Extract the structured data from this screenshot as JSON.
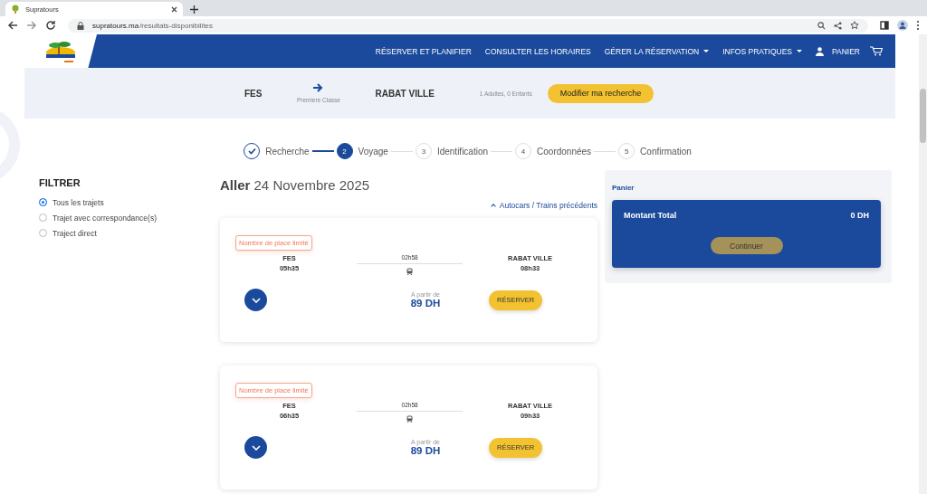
{
  "browser": {
    "tab_title": "Supratours",
    "url_host": "supratours.ma",
    "url_path": "/resultats-disponibilites"
  },
  "nav": {
    "items": [
      {
        "label": "RÉSERVER ET PLANIFIER",
        "caret": false
      },
      {
        "label": "CONSULTER LES HORAIRES",
        "caret": false
      },
      {
        "label": "GÉRER LA RÉSERVATION",
        "caret": true
      },
      {
        "label": "INFOS PRATIQUES",
        "caret": true
      }
    ],
    "cart_label": "PANIER"
  },
  "search_summary": {
    "origin": "FES",
    "class": "Premiere Classe",
    "destination": "RABAT VILLE",
    "passengers": "1 Adultes, 0 Enfants",
    "modify_button": "Modifier ma recherche"
  },
  "steps": [
    {
      "label": "Recherche",
      "completed": true,
      "selected": false
    },
    {
      "number": "2",
      "label": "Voyage",
      "completed": false,
      "selected": true
    },
    {
      "number": "3",
      "label": "Identification",
      "completed": false,
      "selected": false
    },
    {
      "number": "4",
      "label": "Coordonnées",
      "completed": false,
      "selected": false
    },
    {
      "number": "5",
      "label": "Confirmation",
      "completed": false,
      "selected": false
    }
  ],
  "filter": {
    "title": "FILTRER",
    "options": [
      {
        "label": "Tous les trajets",
        "selected": true
      },
      {
        "label": "Trajet avec correspondance(s)",
        "selected": false
      },
      {
        "label": "Traject direct",
        "selected": false
      }
    ]
  },
  "results": {
    "direction": "Aller",
    "date": "24 Novembre 2025",
    "previous_link": "Autocars / Trains précédents",
    "trips": [
      {
        "badge": "Nombre de place limité",
        "from": "FES",
        "departure": "05h35",
        "duration": "02h58",
        "to": "RABAT VILLE",
        "arrival": "08h33",
        "price_label": "A partir de",
        "price": "89 DH",
        "button": "RÉSERVER"
      },
      {
        "badge": "Nombre de place limité",
        "from": "FES",
        "departure": "06h35",
        "duration": "02h58",
        "to": "RABAT VILLE",
        "arrival": "09h33",
        "price_label": "A partir de",
        "price": "89 DH",
        "button": "RÉSERVER"
      }
    ]
  },
  "cart": {
    "title": "Panier",
    "total_label": "Montant Total",
    "total": "0 DH",
    "button": "Continuer"
  }
}
